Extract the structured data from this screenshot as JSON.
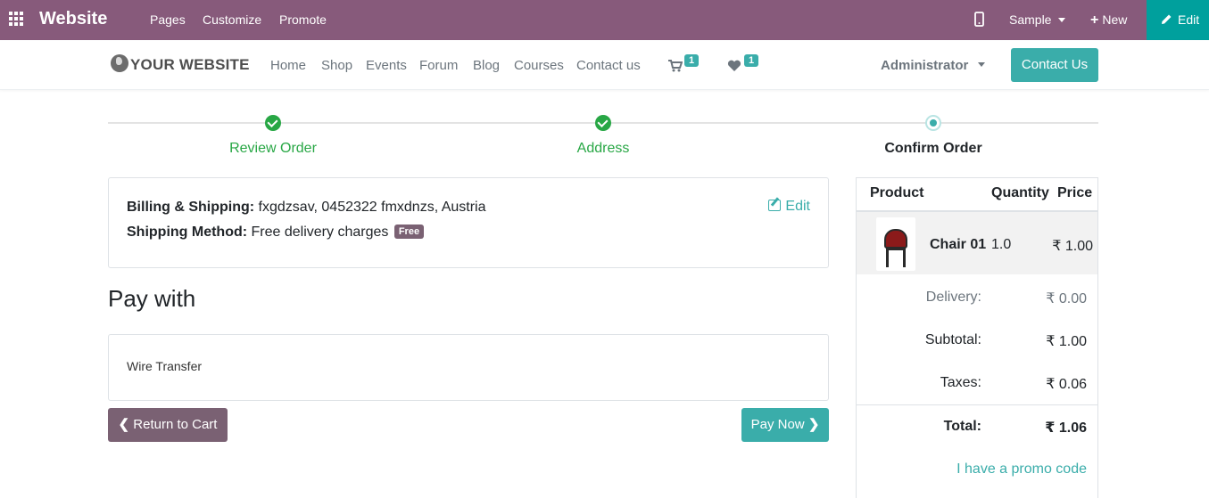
{
  "adminbar": {
    "brand": "Website",
    "menu": [
      "Pages",
      "Customize",
      "Promote"
    ],
    "device_icon": "mobile-icon",
    "sample": "Sample",
    "new": "New",
    "edit": "Edit",
    "bg_color": "#875a7b",
    "edit_color": "#00a09d"
  },
  "navbar": {
    "logo": "YOUR WEBSITE",
    "links": [
      "Home",
      "Shop",
      "Events",
      "Forum",
      "Blog",
      "Courses",
      "Contact us"
    ],
    "cart_count": "1",
    "wishlist_count": "1",
    "user": "Administrator",
    "contact_btn": "Contact Us",
    "accent": "#3aadaa"
  },
  "wizard": {
    "steps": [
      {
        "label": "Review Order",
        "state": "done"
      },
      {
        "label": "Address",
        "state": "done"
      },
      {
        "label": "Confirm Order",
        "state": "current"
      }
    ]
  },
  "billing": {
    "billing_label": "Billing & Shipping:",
    "billing_value": "fxgdzsav, 0452322 fmxdnzs, Austria",
    "shipping_label": "Shipping Method:",
    "shipping_value": "Free delivery charges",
    "free_badge": "Free",
    "edit": "Edit"
  },
  "payment": {
    "title": "Pay with",
    "method": "Wire Transfer",
    "return_btn": "Return to Cart",
    "pay_btn": "Pay Now"
  },
  "summary": {
    "headers": {
      "product": "Product",
      "quantity": "Quantity",
      "price": "Price"
    },
    "lines": [
      {
        "name": "Chair 01",
        "qty": "1.0",
        "price": "₹ 1.00"
      }
    ],
    "delivery_label": "Delivery:",
    "delivery": "₹ 0.00",
    "subtotal_label": "Subtotal:",
    "subtotal": "₹ 1.00",
    "taxes_label": "Taxes:",
    "taxes": "₹ 0.06",
    "total_label": "Total:",
    "total": "₹ 1.06",
    "promo": "I have a promo code"
  }
}
